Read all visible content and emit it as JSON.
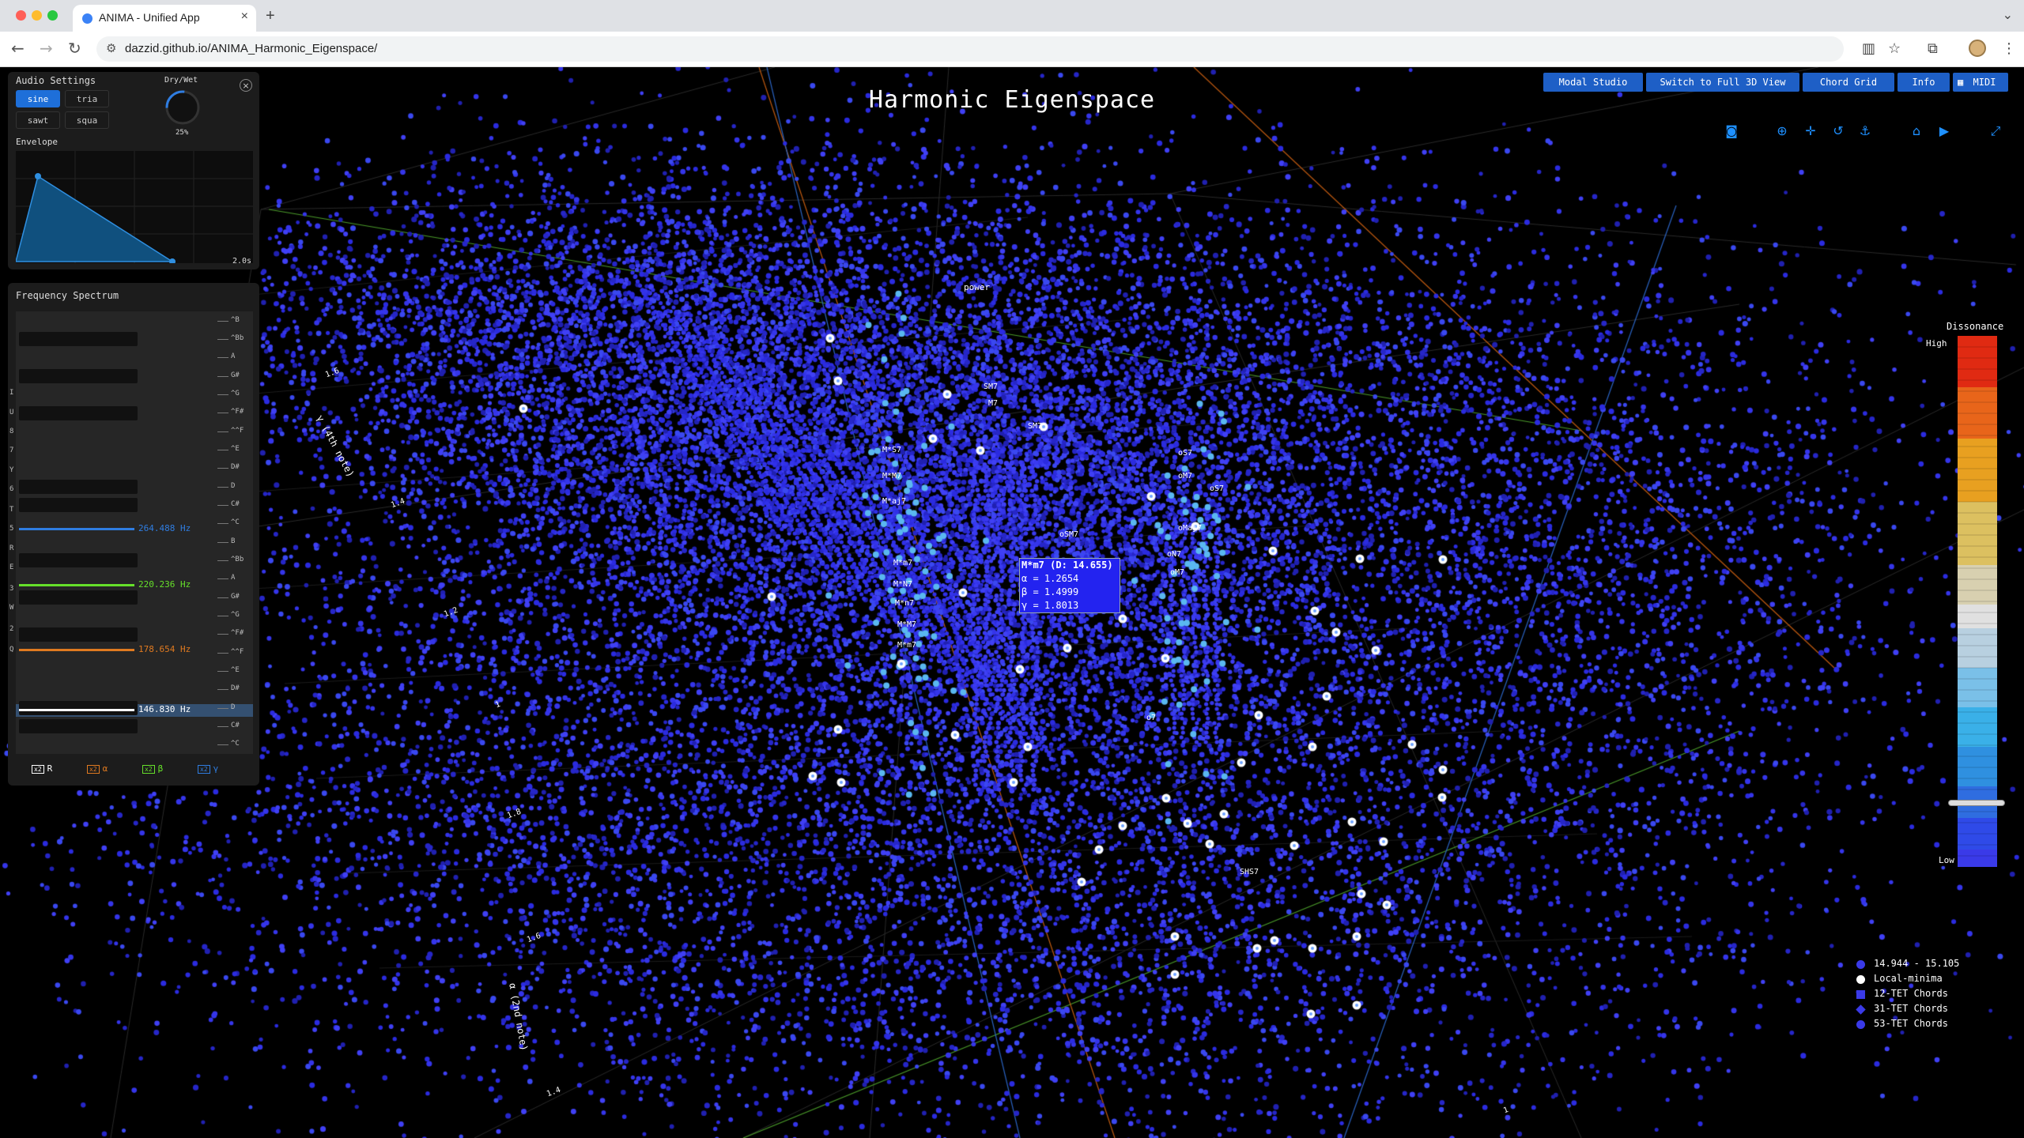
{
  "browser": {
    "tab_title": "ANIMA - Unified App",
    "url": "dazzid.github.io/ANIMA_Harmonic_Eigenspace/"
  },
  "app": {
    "title": "Harmonic Eigenspace",
    "top_buttons": [
      "Modal Studio",
      "Switch to Full 3D View",
      "Chord Grid",
      "Info",
      "MIDI"
    ]
  },
  "audio": {
    "title": "Audio Settings",
    "waveforms": [
      "sine",
      "tria",
      "sawt",
      "squa"
    ],
    "selected_waveform": "sine",
    "drywet_label": "Dry/Wet",
    "drywet_value": "25%",
    "drywet_fraction": 0.25,
    "close_label": "×",
    "envelope_title": "Envelope",
    "envelope_time": "2.0s"
  },
  "spectrum": {
    "title": "Frequency Spectrum",
    "note_labels": [
      "^B",
      "^Bb",
      "A",
      "G#",
      "^G",
      "^F#",
      "^^F",
      "^E",
      "D#",
      "D",
      "C#",
      "^C",
      "B",
      "^Bb",
      "A",
      "G#",
      "^G",
      "^F#",
      "^^F",
      "^E",
      "D#",
      "D",
      "C#",
      "^C"
    ],
    "key_labels": [
      "I",
      "U",
      "8",
      "7",
      "Y",
      "6",
      "T",
      "5",
      "R",
      "E",
      "3",
      "W",
      "2",
      "Q"
    ],
    "freqs": [
      {
        "value": "264.488 Hz",
        "color": "#2f7de1"
      },
      {
        "value": "220.236 Hz",
        "color": "#66e02a"
      },
      {
        "value": "178.654 Hz",
        "color": "#e07a20"
      },
      {
        "value": "146.830 Hz",
        "color": "#ffffff"
      }
    ],
    "legend": [
      {
        "tag": "x2",
        "label": "R",
        "color": "#ffffff"
      },
      {
        "tag": "x2",
        "label": "α",
        "color": "#e07a20"
      },
      {
        "tag": "x2",
        "label": "β",
        "color": "#66e02a"
      },
      {
        "tag": "x2",
        "label": "γ",
        "color": "#2f7de1"
      }
    ]
  },
  "scene": {
    "axis_labels": [
      "γ (4th note)",
      "α (2nd note)"
    ],
    "float_label": "power",
    "tick_labels": [
      "1.6",
      "1.4",
      "1.2",
      "1",
      "1.8",
      "1.6",
      "1.4",
      "1"
    ],
    "chord_labels": [
      "M*S7",
      "M*M7",
      "M*aj7",
      "M*m7",
      "M*N7",
      "M*n7",
      "M*m7",
      "M*M7",
      "o7",
      "SHS7",
      "oS7",
      "oM7",
      "oS7",
      "oMaj7",
      "oN7",
      "oM7",
      "SM7",
      "M7",
      "SM7",
      "oSM7"
    ]
  },
  "tooltip": {
    "title": "M*m7 (D: 14.655)",
    "alpha": "α = 1.2654",
    "beta": "β = 1.4999",
    "gamma": "γ = 1.8013"
  },
  "dissonance": {
    "title": "Dissonance",
    "high": "High",
    "low": "Low",
    "slider_fraction": 0.88
  },
  "legend": [
    {
      "label": "14.944 - 15.105",
      "shape": "circle",
      "color": "#3a3ae8"
    },
    {
      "label": "Local-minima",
      "shape": "circle",
      "color": "#ffffff"
    },
    {
      "label": "12-TET Chords",
      "shape": "square",
      "color": "#3a3ae8"
    },
    {
      "label": "31-TET Chords",
      "shape": "diamond",
      "color": "#3a3ae8"
    },
    {
      "label": "53-TET Chords",
      "shape": "circle",
      "color": "#3a3ae8"
    }
  ]
}
